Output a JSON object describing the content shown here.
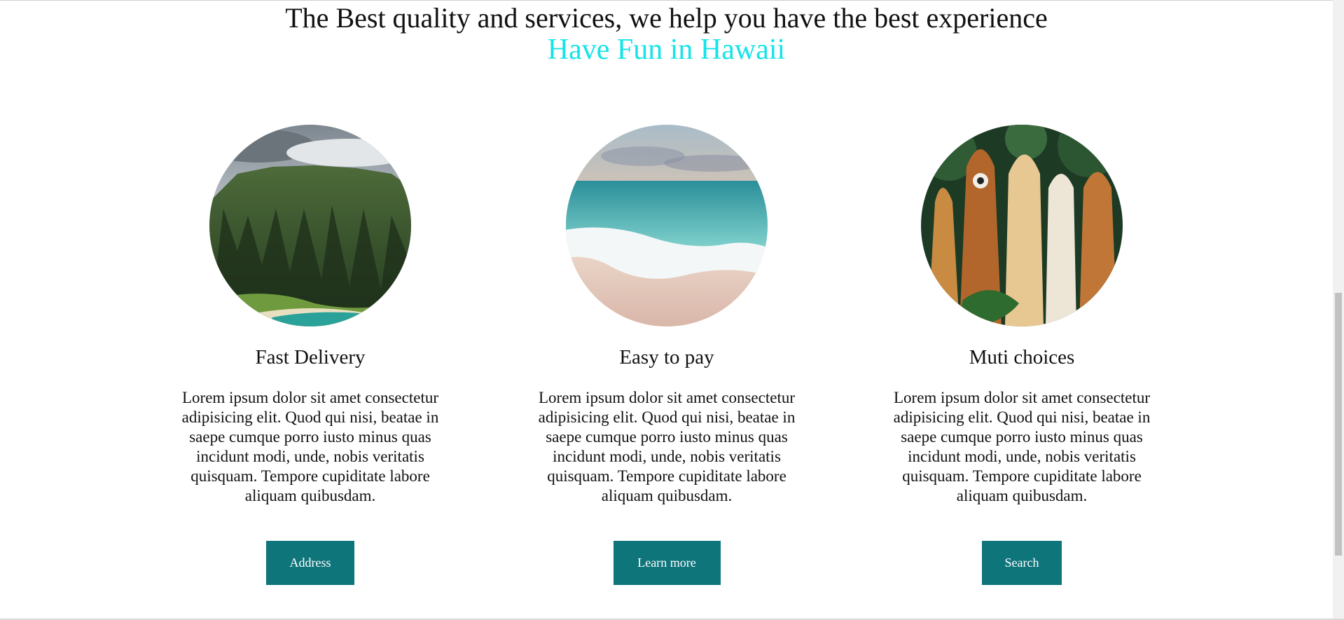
{
  "hero": {
    "title": "The Best quality and services, we help you have the best experience",
    "subtitle": "Have Fun in Hawaii",
    "subtitle_color": "#16e3e8"
  },
  "cards": [
    {
      "image": "mountain-coast-photo",
      "title": "Fast Delivery",
      "text": "Lorem ipsum dolor sit amet consectetur adipisicing elit. Quod qui nisi, beatae in saepe cumque porro iusto minus quas incidunt modi, unde, nobis veritatis quisquam. Tempore cupiditate labore aliquam quibusdam.",
      "button": "Address"
    },
    {
      "image": "beach-waves-photo",
      "title": "Easy to pay",
      "text": "Lorem ipsum dolor sit amet consectetur adipisicing elit. Quod qui nisi, beatae in saepe cumque porro iusto minus quas incidunt modi, unde, nobis veritatis quisquam. Tempore cupiditate labore aliquam quibusdam.",
      "button": "Learn more"
    },
    {
      "image": "surfboards-photo",
      "title": "Muti choices",
      "text": "Lorem ipsum dolor sit amet consectetur adipisicing elit. Quod qui nisi, beatae in saepe cumque porro iusto minus quas incidunt modi, unde, nobis veritatis quisquam. Tempore cupiditate labore aliquam quibusdam.",
      "button": "Search"
    }
  ],
  "colors": {
    "button_bg": "#0e757b",
    "button_text": "#ffffff"
  }
}
